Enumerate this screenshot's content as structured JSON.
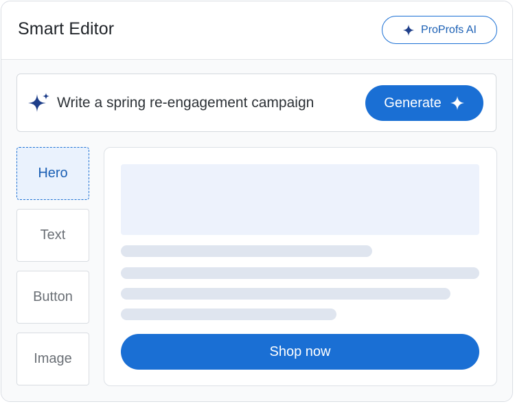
{
  "header": {
    "title": "Smart Editor",
    "badge_label": "ProProfs AI",
    "badge_icon": "sparkle-icon"
  },
  "prompt": {
    "text": "Write a spring re-engagement campaign",
    "icon": "sparkle-icon",
    "generate_label": "Generate",
    "generate_icon": "sparkle-icon"
  },
  "blocks": [
    {
      "label": "Hero",
      "active": true
    },
    {
      "label": "Text",
      "active": false
    },
    {
      "label": "Button",
      "active": false
    },
    {
      "label": "Image",
      "active": false
    }
  ],
  "preview": {
    "cta_label": "Shop now"
  },
  "colors": {
    "accent": "#1a6fd4",
    "accent_light": "#eaf2fd",
    "placeholder": "#dfe5ef",
    "hero_placeholder": "#edf2fc"
  }
}
